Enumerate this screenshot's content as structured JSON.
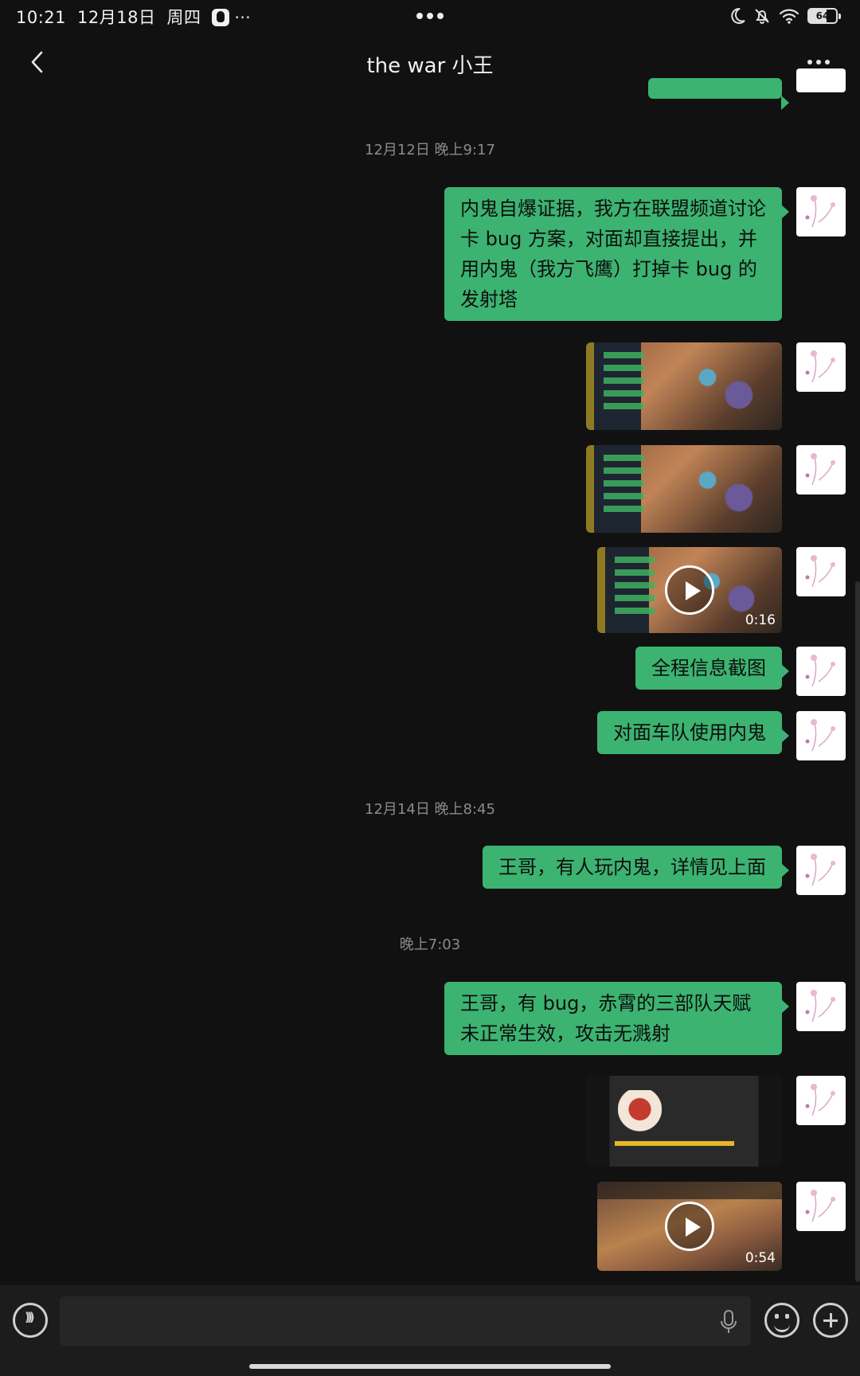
{
  "status_bar": {
    "time": "10:21",
    "date": "12月18日",
    "weekday": "周四",
    "notification_icon": "qq-icon",
    "more_dots": "···",
    "battery": "64"
  },
  "header": {
    "title": "the war 小王",
    "back_icon": "chevron-left-icon",
    "more_icon": "more-dots-icon"
  },
  "messages": {
    "ts1": "12月12日 晚上9:17",
    "m1": "内鬼自爆证据，我方在联盟频道讨论卡 bug 方案，对面却直接提出，并用内鬼（我方飞鹰）打掉卡 bug 的发射塔",
    "video1_duration": "0:16",
    "m2": "全程信息截图",
    "m3": "对面车队使用内鬼",
    "ts2": "12月14日 晚上8:45",
    "m4": "王哥，有人玩内鬼，详情见上面",
    "ts3": "晚上7:03",
    "m5": "王哥，有 bug，赤霄的三部队天赋未正常生效，攻击无溅射",
    "video2_duration": "0:54"
  },
  "input_bar": {
    "placeholder": "",
    "icons": [
      "voice-icon",
      "mic-icon",
      "emoji-icon",
      "plus-icon"
    ]
  },
  "colors": {
    "background": "#111111",
    "bubble": "#3cb371",
    "input_bar": "#1c1c1c"
  }
}
